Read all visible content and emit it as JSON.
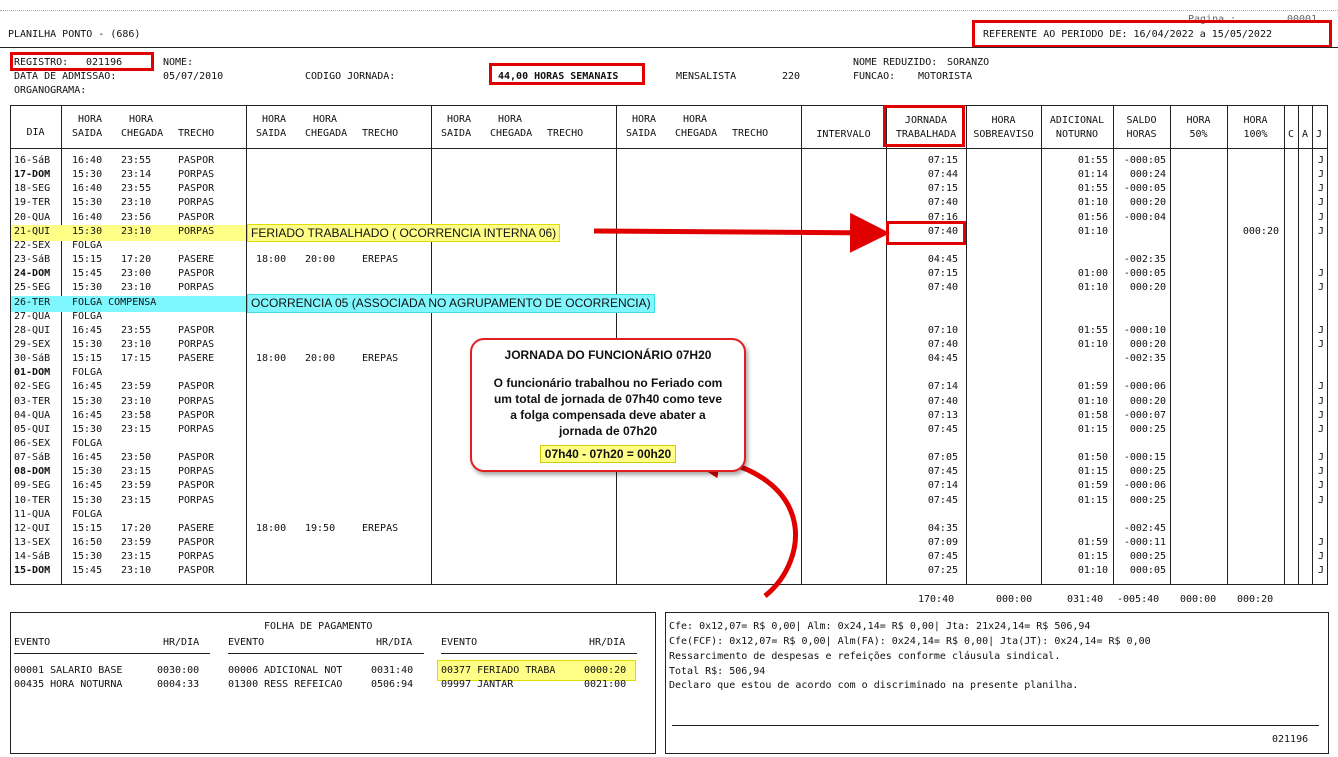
{
  "header": {
    "title": "PLANILHA PONTO - (686)",
    "page_label": "Pagina :",
    "page_value": "00001",
    "period": "REFERENTE AO PERIODO DE: 16/04/2022 a 15/05/2022"
  },
  "employee": {
    "registro_label": "REGISTRO:",
    "registro": "021196",
    "nome_label": "NOME:",
    "nome": "",
    "nome_reduzido_label": "NOME REDUZIDO:",
    "nome_reduzido": "SORANZO",
    "admissao_label": "DATA DE ADMISSAO:",
    "admissao": "05/07/2010",
    "codigo_label": "CODIGO JORNADA:",
    "codigo": "44,00 HORAS SEMANAIS",
    "tipo": "MENSALISTA",
    "tipo_num": "220",
    "funcao_label": "FUNCAO:",
    "funcao": "MOTORISTA",
    "organograma_label": "ORGANOGRAMA:"
  },
  "columns": {
    "dia": "DIA",
    "hora": "HORA",
    "saida": "SAIDA",
    "chegada": "CHEGADA",
    "trecho": "TRECHO",
    "intervalo": "INTERVALO",
    "jornada1": "JORNADA",
    "jornada2": "TRABALHADA",
    "sobreaviso1": "HORA",
    "sobreaviso2": "SOBREAVISO",
    "noturno1": "ADICIONAL",
    "noturno2": "NOTURNO",
    "saldo1": "SALDO",
    "saldo2": "HORAS",
    "h50_1": "HORA",
    "h50_2": "50%",
    "h100_1": "HORA",
    "h100_2": "100%",
    "c": "C",
    "a": "A",
    "j": "J"
  },
  "rows": [
    {
      "dia": "16-SáB",
      "s1": "16:40",
      "c1": "23:55",
      "t1": "PASPOR",
      "s2": "",
      "c2": "",
      "t2": "",
      "jor": "07:15",
      "not": "01:55",
      "saldo": "-000:05",
      "h100": "",
      "j": "J",
      "bold": false,
      "hl": ""
    },
    {
      "dia": "17-DOM",
      "s1": "15:30",
      "c1": "23:14",
      "t1": "PORPAS",
      "s2": "",
      "c2": "",
      "t2": "",
      "jor": "07:44",
      "not": "01:14",
      "saldo": "000:24",
      "h100": "",
      "j": "J",
      "bold": true,
      "hl": ""
    },
    {
      "dia": "18-SEG",
      "s1": "16:40",
      "c1": "23:55",
      "t1": "PASPOR",
      "s2": "",
      "c2": "",
      "t2": "",
      "jor": "07:15",
      "not": "01:55",
      "saldo": "-000:05",
      "h100": "",
      "j": "J",
      "bold": false,
      "hl": ""
    },
    {
      "dia": "19-TER",
      "s1": "15:30",
      "c1": "23:10",
      "t1": "PORPAS",
      "s2": "",
      "c2": "",
      "t2": "",
      "jor": "07:40",
      "not": "01:10",
      "saldo": "000:20",
      "h100": "",
      "j": "J",
      "bold": false,
      "hl": ""
    },
    {
      "dia": "20-QUA",
      "s1": "16:40",
      "c1": "23:56",
      "t1": "PASPOR",
      "s2": "",
      "c2": "",
      "t2": "",
      "jor": "07:16",
      "not": "01:56",
      "saldo": "-000:04",
      "h100": "",
      "j": "J",
      "bold": false,
      "hl": ""
    },
    {
      "dia": "21-QUI",
      "s1": "15:30",
      "c1": "23:10",
      "t1": "PORPAS",
      "s2": "",
      "c2": "",
      "t2": "",
      "jor": "07:40",
      "not": "01:10",
      "saldo": "",
      "h100": "000:20",
      "j": "J",
      "bold": false,
      "hl": "yellow"
    },
    {
      "dia": "22-SEX",
      "s1": "FOLGA",
      "c1": "",
      "t1": "",
      "s2": "",
      "c2": "",
      "t2": "",
      "jor": "",
      "not": "",
      "saldo": "",
      "h100": "",
      "j": "",
      "bold": false,
      "hl": ""
    },
    {
      "dia": "23-SáB",
      "s1": "15:15",
      "c1": "17:20",
      "t1": "PASERE",
      "s2": "18:00",
      "c2": "20:00",
      "t2": "EREPAS",
      "jor": "04:45",
      "not": "",
      "saldo": "-002:35",
      "h100": "",
      "j": "",
      "bold": false,
      "hl": ""
    },
    {
      "dia": "24-DOM",
      "s1": "15:45",
      "c1": "23:00",
      "t1": "PASPOR",
      "s2": "",
      "c2": "",
      "t2": "",
      "jor": "07:15",
      "not": "01:00",
      "saldo": "-000:05",
      "h100": "",
      "j": "J",
      "bold": true,
      "hl": ""
    },
    {
      "dia": "25-SEG",
      "s1": "15:30",
      "c1": "23:10",
      "t1": "PORPAS",
      "s2": "",
      "c2": "",
      "t2": "",
      "jor": "07:40",
      "not": "01:10",
      "saldo": "000:20",
      "h100": "",
      "j": "J",
      "bold": false,
      "hl": ""
    },
    {
      "dia": "26-TER",
      "s1": "FOLGA COMPENSA",
      "c1": "",
      "t1": "",
      "s2": "",
      "c2": "",
      "t2": "",
      "jor": "",
      "not": "",
      "saldo": "",
      "h100": "",
      "j": "",
      "bold": false,
      "hl": "cyan"
    },
    {
      "dia": "27-QUA",
      "s1": "FOLGA",
      "c1": "",
      "t1": "",
      "s2": "",
      "c2": "",
      "t2": "",
      "jor": "",
      "not": "",
      "saldo": "",
      "h100": "",
      "j": "",
      "bold": false,
      "hl": ""
    },
    {
      "dia": "28-QUI",
      "s1": "16:45",
      "c1": "23:55",
      "t1": "PASPOR",
      "s2": "",
      "c2": "",
      "t2": "",
      "jor": "07:10",
      "not": "01:55",
      "saldo": "-000:10",
      "h100": "",
      "j": "J",
      "bold": false,
      "hl": ""
    },
    {
      "dia": "29-SEX",
      "s1": "15:30",
      "c1": "23:10",
      "t1": "PORPAS",
      "s2": "",
      "c2": "",
      "t2": "",
      "jor": "07:40",
      "not": "01:10",
      "saldo": "000:20",
      "h100": "",
      "j": "J",
      "bold": false,
      "hl": ""
    },
    {
      "dia": "30-SáB",
      "s1": "15:15",
      "c1": "17:15",
      "t1": "PASERE",
      "s2": "18:00",
      "c2": "20:00",
      "t2": "EREPAS",
      "jor": "04:45",
      "not": "",
      "saldo": "-002:35",
      "h100": "",
      "j": "",
      "bold": false,
      "hl": ""
    },
    {
      "dia": "01-DOM",
      "s1": "FOLGA",
      "c1": "",
      "t1": "",
      "s2": "",
      "c2": "",
      "t2": "",
      "jor": "",
      "not": "",
      "saldo": "",
      "h100": "",
      "j": "",
      "bold": true,
      "hl": ""
    },
    {
      "dia": "02-SEG",
      "s1": "16:45",
      "c1": "23:59",
      "t1": "PASPOR",
      "s2": "",
      "c2": "",
      "t2": "",
      "jor": "07:14",
      "not": "01:59",
      "saldo": "-000:06",
      "h100": "",
      "j": "J",
      "bold": false,
      "hl": ""
    },
    {
      "dia": "03-TER",
      "s1": "15:30",
      "c1": "23:10",
      "t1": "PORPAS",
      "s2": "",
      "c2": "",
      "t2": "",
      "jor": "07:40",
      "not": "01:10",
      "saldo": "000:20",
      "h100": "",
      "j": "J",
      "bold": false,
      "hl": ""
    },
    {
      "dia": "04-QUA",
      "s1": "16:45",
      "c1": "23:58",
      "t1": "PASPOR",
      "s2": "",
      "c2": "",
      "t2": "",
      "jor": "07:13",
      "not": "01:58",
      "saldo": "-000:07",
      "h100": "",
      "j": "J",
      "bold": false,
      "hl": ""
    },
    {
      "dia": "05-QUI",
      "s1": "15:30",
      "c1": "23:15",
      "t1": "PORPAS",
      "s2": "",
      "c2": "",
      "t2": "",
      "jor": "07:45",
      "not": "01:15",
      "saldo": "000:25",
      "h100": "",
      "j": "J",
      "bold": false,
      "hl": ""
    },
    {
      "dia": "06-SEX",
      "s1": "FOLGA",
      "c1": "",
      "t1": "",
      "s2": "",
      "c2": "",
      "t2": "",
      "jor": "",
      "not": "",
      "saldo": "",
      "h100": "",
      "j": "",
      "bold": false,
      "hl": ""
    },
    {
      "dia": "07-SáB",
      "s1": "16:45",
      "c1": "23:50",
      "t1": "PASPOR",
      "s2": "",
      "c2": "",
      "t2": "",
      "jor": "07:05",
      "not": "01:50",
      "saldo": "-000:15",
      "h100": "",
      "j": "J",
      "bold": false,
      "hl": ""
    },
    {
      "dia": "08-DOM",
      "s1": "15:30",
      "c1": "23:15",
      "t1": "PORPAS",
      "s2": "",
      "c2": "",
      "t2": "",
      "jor": "07:45",
      "not": "01:15",
      "saldo": "000:25",
      "h100": "",
      "j": "J",
      "bold": true,
      "hl": ""
    },
    {
      "dia": "09-SEG",
      "s1": "16:45",
      "c1": "23:59",
      "t1": "PASPOR",
      "s2": "",
      "c2": "",
      "t2": "",
      "jor": "07:14",
      "not": "01:59",
      "saldo": "-000:06",
      "h100": "",
      "j": "J",
      "bold": false,
      "hl": ""
    },
    {
      "dia": "10-TER",
      "s1": "15:30",
      "c1": "23:15",
      "t1": "PORPAS",
      "s2": "",
      "c2": "",
      "t2": "",
      "jor": "07:45",
      "not": "01:15",
      "saldo": "000:25",
      "h100": "",
      "j": "J",
      "bold": false,
      "hl": ""
    },
    {
      "dia": "11-QUA",
      "s1": "FOLGA",
      "c1": "",
      "t1": "",
      "s2": "",
      "c2": "",
      "t2": "",
      "jor": "",
      "not": "",
      "saldo": "",
      "h100": "",
      "j": "",
      "bold": false,
      "hl": ""
    },
    {
      "dia": "12-QUI",
      "s1": "15:15",
      "c1": "17:20",
      "t1": "PASERE",
      "s2": "18:00",
      "c2": "19:50",
      "t2": "EREPAS",
      "jor": "04:35",
      "not": "",
      "saldo": "-002:45",
      "h100": "",
      "j": "",
      "bold": false,
      "hl": ""
    },
    {
      "dia": "13-SEX",
      "s1": "16:50",
      "c1": "23:59",
      "t1": "PASPOR",
      "s2": "",
      "c2": "",
      "t2": "",
      "jor": "07:09",
      "not": "01:59",
      "saldo": "-000:11",
      "h100": "",
      "j": "J",
      "bold": false,
      "hl": ""
    },
    {
      "dia": "14-SáB",
      "s1": "15:30",
      "c1": "23:15",
      "t1": "PORPAS",
      "s2": "",
      "c2": "",
      "t2": "",
      "jor": "07:45",
      "not": "01:15",
      "saldo": "000:25",
      "h100": "",
      "j": "J",
      "bold": false,
      "hl": ""
    },
    {
      "dia": "15-DOM",
      "s1": "15:45",
      "c1": "23:10",
      "t1": "PASPOR",
      "s2": "",
      "c2": "",
      "t2": "",
      "jor": "07:25",
      "not": "01:10",
      "saldo": "000:05",
      "h100": "",
      "j": "J",
      "bold": true,
      "hl": ""
    }
  ],
  "totals": {
    "jornada": "170:40",
    "sobreaviso": "000:00",
    "noturno": "031:40",
    "saldo": "-005:40",
    "h50": "000:00",
    "h100": "000:20"
  },
  "annotations": {
    "feriado": "FERIADO TRABALHADO ( OCORRENCIA INTERNA 06)",
    "ocorrencia": "OCORRENCIA 05 (ASSOCIADA NO AGRUPAMENTO DE OCORRENCIA)",
    "callout_title": "JORNADA DO FUNCIONÁRIO 07H20",
    "callout_body": "O funcionário trabalhou no Feriado com um total de jornada de 07h40 como teve a folga compensada deve abater a jornada de 07h20",
    "callout_calc": "07h40 - 07h20 = 00h20"
  },
  "payroll": {
    "title": "FOLHA DE PAGAMENTO",
    "evento_label": "EVENTO",
    "hrdia_label": "HR/DIA",
    "col1": [
      {
        "evento": "00001 SALARIO BASE",
        "hr": "0030:00"
      },
      {
        "evento": "00435 HORA NOTURNA",
        "hr": "0004:33"
      }
    ],
    "col2": [
      {
        "evento": "00006 ADICIONAL NOT",
        "hr": "0031:40"
      },
      {
        "evento": "01300 RESS REFEICAO",
        "hr": "0506:94"
      }
    ],
    "col3": [
      {
        "evento": "00377 FERIADO TRABA",
        "hr": "0000:20"
      },
      {
        "evento": "09997 JANTAR",
        "hr": "0021:00"
      }
    ]
  },
  "notes": {
    "line1": "Cfe: 0x12,07= R$ 0,00| Alm: 0x24,14= R$ 0,00| Jta: 21x24,14= R$ 506,94",
    "line2": "Cfe(FCF): 0x12,07= R$ 0,00| Alm(FA): 0x24,14= R$ 0,00| Jta(JT): 0x24,14= R$ 0,00",
    "line3": "Ressarcimento de despesas e refeições conforme cláusula sindical.",
    "line4": "Total R$: 506,94",
    "line5": "Declaro que estou de acordo com o discriminado na presente planilha.",
    "signature_id": "021196"
  },
  "colors": {
    "annotation_red": "#e00000",
    "highlight_yellow": "#ffff88",
    "highlight_cyan": "#7ff7ff"
  }
}
